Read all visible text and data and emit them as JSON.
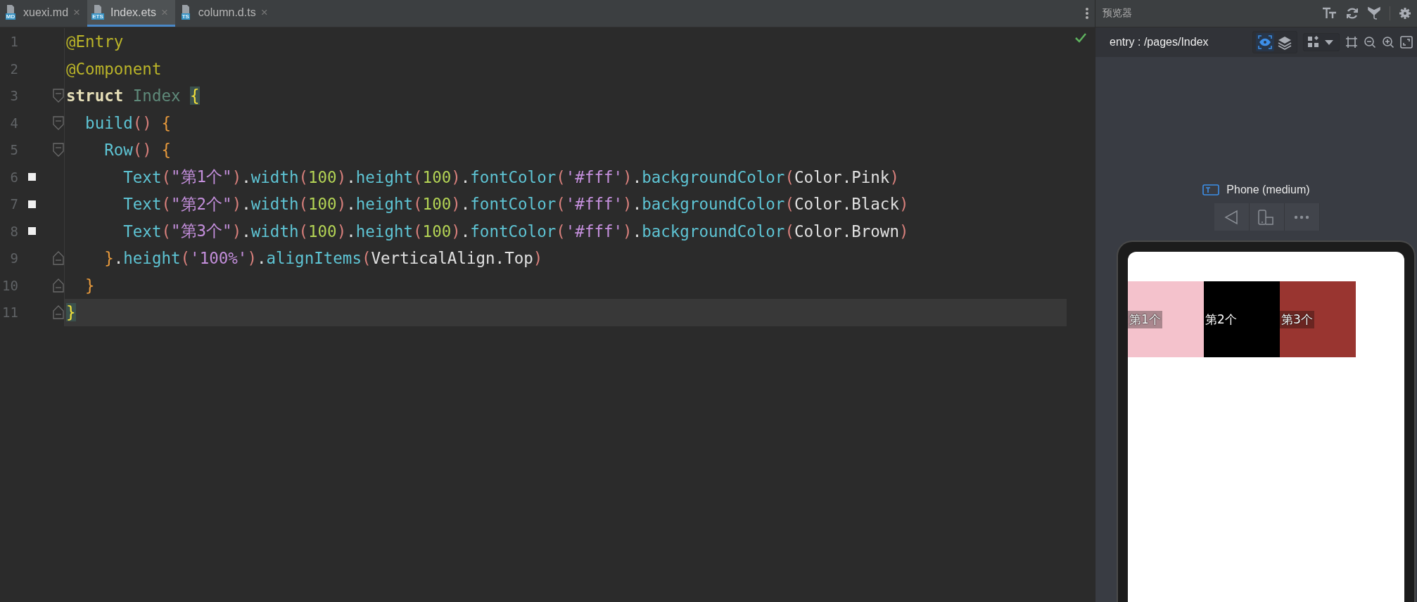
{
  "tabs": [
    {
      "label": "xuexi.md",
      "badge": "MD",
      "close": "×",
      "selected": false
    },
    {
      "label": "Index.ets",
      "badge": "ETS",
      "close": "×",
      "selected": true
    },
    {
      "label": "column.d.ts",
      "badge": "TS",
      "close": "×",
      "selected": false
    }
  ],
  "editor": {
    "lines": [
      {
        "number": "1",
        "marker": false,
        "current": false,
        "fold_start": false,
        "fold_end": false,
        "tokens": [
          {
            "kind": "dec",
            "text": "@Entry"
          }
        ]
      },
      {
        "number": "2",
        "marker": false,
        "current": false,
        "fold_start": false,
        "fold_end": false,
        "tokens": [
          {
            "kind": "dec",
            "text": "@Component"
          }
        ]
      },
      {
        "number": "3",
        "marker": false,
        "current": false,
        "fold_start": true,
        "fold_end": false,
        "tokens": [
          {
            "kind": "kw",
            "text": "struct "
          },
          {
            "kind": "cls",
            "text": "Index "
          },
          {
            "kind": "match",
            "text": "{"
          }
        ]
      },
      {
        "number": "4",
        "marker": false,
        "current": false,
        "fold_start": true,
        "fold_end": false,
        "tokens": [
          {
            "kind": "fn",
            "text": "  build"
          },
          {
            "kind": "paren",
            "text": "()"
          },
          {
            "kind": "brace",
            "text": " {"
          }
        ]
      },
      {
        "number": "5",
        "marker": false,
        "current": false,
        "fold_start": true,
        "fold_end": false,
        "tokens": [
          {
            "kind": "fn",
            "text": "    Row"
          },
          {
            "kind": "paren",
            "text": "()"
          },
          {
            "kind": "brace",
            "text": " {"
          }
        ]
      },
      {
        "number": "6",
        "marker": true,
        "current": false,
        "fold_start": false,
        "fold_end": false,
        "tokens": [
          {
            "kind": "fn",
            "text": "      Text"
          },
          {
            "kind": "paren",
            "text": "("
          },
          {
            "kind": "str",
            "text": "\"第1个\""
          },
          {
            "kind": "paren",
            "text": ")"
          },
          {
            "kind": "plain",
            "text": "."
          },
          {
            "kind": "fn",
            "text": "width"
          },
          {
            "kind": "paren",
            "text": "("
          },
          {
            "kind": "num",
            "text": "100"
          },
          {
            "kind": "paren",
            "text": ")"
          },
          {
            "kind": "plain",
            "text": "."
          },
          {
            "kind": "fn",
            "text": "height"
          },
          {
            "kind": "paren",
            "text": "("
          },
          {
            "kind": "num",
            "text": "100"
          },
          {
            "kind": "paren",
            "text": ")"
          },
          {
            "kind": "plain",
            "text": "."
          },
          {
            "kind": "fn",
            "text": "fontColor"
          },
          {
            "kind": "paren",
            "text": "("
          },
          {
            "kind": "str",
            "text": "'#fff'"
          },
          {
            "kind": "paren",
            "text": ")"
          },
          {
            "kind": "plain",
            "text": "."
          },
          {
            "kind": "fn",
            "text": "backgroundColor"
          },
          {
            "kind": "paren",
            "text": "("
          },
          {
            "kind": "plain",
            "text": "Color.Pink"
          },
          {
            "kind": "paren",
            "text": ")"
          }
        ]
      },
      {
        "number": "7",
        "marker": true,
        "current": false,
        "fold_start": false,
        "fold_end": false,
        "tokens": [
          {
            "kind": "fn",
            "text": "      Text"
          },
          {
            "kind": "paren",
            "text": "("
          },
          {
            "kind": "str",
            "text": "\"第2个\""
          },
          {
            "kind": "paren",
            "text": ")"
          },
          {
            "kind": "plain",
            "text": "."
          },
          {
            "kind": "fn",
            "text": "width"
          },
          {
            "kind": "paren",
            "text": "("
          },
          {
            "kind": "num",
            "text": "100"
          },
          {
            "kind": "paren",
            "text": ")"
          },
          {
            "kind": "plain",
            "text": "."
          },
          {
            "kind": "fn",
            "text": "height"
          },
          {
            "kind": "paren",
            "text": "("
          },
          {
            "kind": "num",
            "text": "100"
          },
          {
            "kind": "paren",
            "text": ")"
          },
          {
            "kind": "plain",
            "text": "."
          },
          {
            "kind": "fn",
            "text": "fontColor"
          },
          {
            "kind": "paren",
            "text": "("
          },
          {
            "kind": "str",
            "text": "'#fff'"
          },
          {
            "kind": "paren",
            "text": ")"
          },
          {
            "kind": "plain",
            "text": "."
          },
          {
            "kind": "fn",
            "text": "backgroundColor"
          },
          {
            "kind": "paren",
            "text": "("
          },
          {
            "kind": "plain",
            "text": "Color.Black"
          },
          {
            "kind": "paren",
            "text": ")"
          }
        ]
      },
      {
        "number": "8",
        "marker": true,
        "current": false,
        "fold_start": false,
        "fold_end": false,
        "tokens": [
          {
            "kind": "fn",
            "text": "      Text"
          },
          {
            "kind": "paren",
            "text": "("
          },
          {
            "kind": "str",
            "text": "\"第3个\""
          },
          {
            "kind": "paren",
            "text": ")"
          },
          {
            "kind": "plain",
            "text": "."
          },
          {
            "kind": "fn",
            "text": "width"
          },
          {
            "kind": "paren",
            "text": "("
          },
          {
            "kind": "num",
            "text": "100"
          },
          {
            "kind": "paren",
            "text": ")"
          },
          {
            "kind": "plain",
            "text": "."
          },
          {
            "kind": "fn",
            "text": "height"
          },
          {
            "kind": "paren",
            "text": "("
          },
          {
            "kind": "num",
            "text": "100"
          },
          {
            "kind": "paren",
            "text": ")"
          },
          {
            "kind": "plain",
            "text": "."
          },
          {
            "kind": "fn",
            "text": "fontColor"
          },
          {
            "kind": "paren",
            "text": "("
          },
          {
            "kind": "str",
            "text": "'#fff'"
          },
          {
            "kind": "paren",
            "text": ")"
          },
          {
            "kind": "plain",
            "text": "."
          },
          {
            "kind": "fn",
            "text": "backgroundColor"
          },
          {
            "kind": "paren",
            "text": "("
          },
          {
            "kind": "plain",
            "text": "Color.Brown"
          },
          {
            "kind": "paren",
            "text": ")"
          }
        ]
      },
      {
        "number": "9",
        "marker": false,
        "current": false,
        "fold_start": false,
        "fold_end": true,
        "tokens": [
          {
            "kind": "brace",
            "text": "    }"
          },
          {
            "kind": "plain",
            "text": "."
          },
          {
            "kind": "fn",
            "text": "height"
          },
          {
            "kind": "paren",
            "text": "("
          },
          {
            "kind": "str",
            "text": "'100%'"
          },
          {
            "kind": "paren",
            "text": ")"
          },
          {
            "kind": "plain",
            "text": "."
          },
          {
            "kind": "fn",
            "text": "alignItems"
          },
          {
            "kind": "paren",
            "text": "("
          },
          {
            "kind": "plain",
            "text": "VerticalAlign.Top"
          },
          {
            "kind": "paren",
            "text": ")"
          }
        ]
      },
      {
        "number": "10",
        "marker": false,
        "current": false,
        "fold_start": false,
        "fold_end": true,
        "tokens": [
          {
            "kind": "brace",
            "text": "  }"
          }
        ]
      },
      {
        "number": "11",
        "marker": false,
        "current": true,
        "fold_start": false,
        "fold_end": true,
        "tokens": [
          {
            "kind": "match",
            "text": "}"
          }
        ]
      }
    ]
  },
  "preview": {
    "title": "预览器",
    "route": "entry : /pages/Index",
    "view_toggles": [
      {
        "kind": "eye",
        "selected": true
      },
      {
        "kind": "layers",
        "selected": false
      }
    ],
    "device": "Phone (medium)",
    "boxes": [
      {
        "label": "第1个",
        "color": "#f4c2cc"
      },
      {
        "label": "第2个",
        "color": "#000000"
      },
      {
        "label": "第3个",
        "color": "#993530"
      }
    ]
  }
}
